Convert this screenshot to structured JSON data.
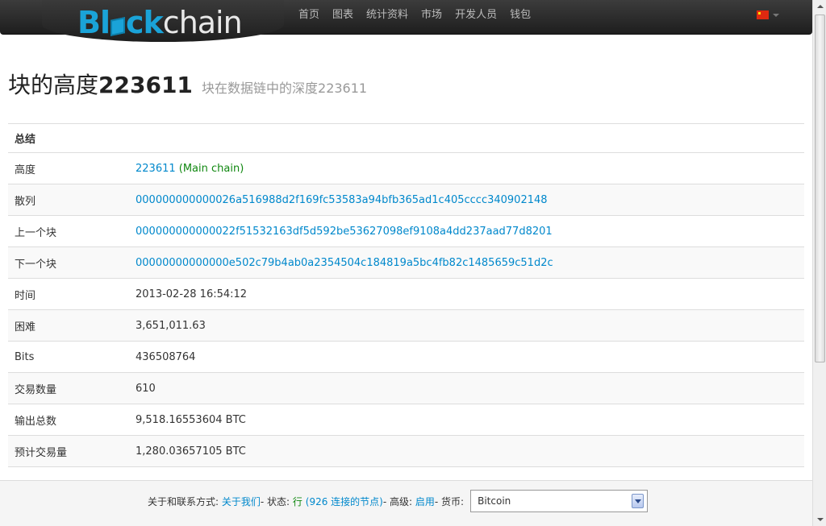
{
  "logo": {
    "part1": "Bl",
    "part2": "ck",
    "part3": "chain"
  },
  "nav": [
    "首页",
    "图表",
    "统计资料",
    "市场",
    "开发人员",
    "钱包"
  ],
  "heading": {
    "title": "块的高度",
    "height": "223611",
    "subtitle": "块在数据链中的深度223611"
  },
  "table": {
    "header": "总结",
    "rows": [
      {
        "label": "高度",
        "value": "223611",
        "extra": " (Main chain)"
      },
      {
        "label": "散列",
        "value": "000000000000026a516988d2f169fc53583a94bfb365ad1c405cccc340902148"
      },
      {
        "label": "上一个块",
        "value": "000000000000022f51532163df5d592be53627098ef9108a4dd237aad77d8201"
      },
      {
        "label": "下一个块",
        "value": "00000000000000e502c79b4ab0a2354504c184819a5bc4fb82c1485659c51d2c"
      },
      {
        "label": "时间",
        "value": "2013-02-28 16:54:12"
      },
      {
        "label": "困难",
        "value": "3,651,011.63"
      },
      {
        "label": "Bits",
        "value": "436508764"
      },
      {
        "label": "交易数量",
        "value": "610"
      },
      {
        "label": "输出总数",
        "value": "9,518.16553604 BTC"
      },
      {
        "label": "预计交易量",
        "value": "1,280.03657105 BTC"
      }
    ]
  },
  "footer": {
    "about_prefix": "关于和联系方式:",
    "about_link": "关于我们",
    "status_prefix": " - 状态:",
    "status_ok": "行",
    "status_nodes": "(926 连接的节点)",
    "advanced_prefix": " - 高级:",
    "advanced_link": "启用",
    "currency_prefix": " - 货币:",
    "currency_value": "Bitcoin"
  },
  "colors": {
    "link": "#0088cc",
    "status_green": "#118811",
    "brand_blue": "#1aa3d8"
  }
}
